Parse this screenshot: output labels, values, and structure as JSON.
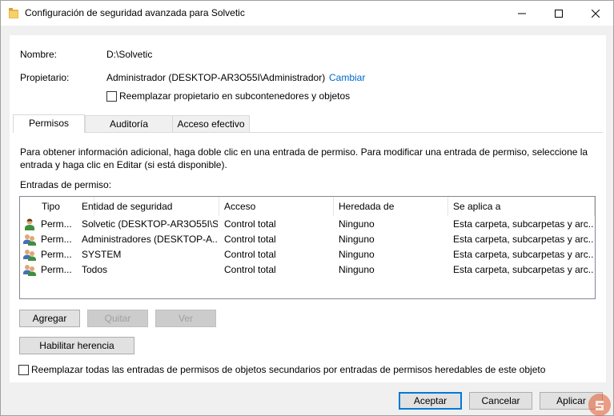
{
  "window": {
    "title": "Configuración de seguridad avanzada para Solvetic"
  },
  "info": {
    "name_label": "Nombre:",
    "name_value": "D:\\Solvetic",
    "owner_label": "Propietario:",
    "owner_value": "Administrador (DESKTOP-AR3O55I\\Administrador)",
    "change_link": "Cambiar",
    "replace_owner_label": "Reemplazar propietario en subcontenedores y objetos"
  },
  "tabs": [
    {
      "label": "Permisos",
      "active": true
    },
    {
      "label": "Auditoría",
      "active": false
    },
    {
      "label": "Acceso efectivo",
      "active": false
    }
  ],
  "description": "Para obtener información adicional, haga doble clic en una entrada de permiso. Para modificar una entrada de permiso, seleccione la entrada y haga clic en Editar (si está disponible).",
  "entries_label": "Entradas de permiso:",
  "table": {
    "columns": [
      "Tipo",
      "Entidad de seguridad",
      "Acceso",
      "Heredada de",
      "Se aplica a"
    ],
    "rows": [
      {
        "icon": "single-user-icon",
        "tipo": "Perm...",
        "entidad": "Solvetic (DESKTOP-AR3O55I\\S...",
        "acceso": "Control total",
        "heredada": "Ninguno",
        "aplica": "Esta carpeta, subcarpetas y arc..."
      },
      {
        "icon": "group-users-icon",
        "tipo": "Perm...",
        "entidad": "Administradores (DESKTOP-A...",
        "acceso": "Control total",
        "heredada": "Ninguno",
        "aplica": "Esta carpeta, subcarpetas y arc..."
      },
      {
        "icon": "group-users-icon",
        "tipo": "Perm...",
        "entidad": "SYSTEM",
        "acceso": "Control total",
        "heredada": "Ninguno",
        "aplica": "Esta carpeta, subcarpetas y arc..."
      },
      {
        "icon": "group-users-icon",
        "tipo": "Perm...",
        "entidad": "Todos",
        "acceso": "Control total",
        "heredada": "Ninguno",
        "aplica": "Esta carpeta, subcarpetas y arc..."
      }
    ]
  },
  "buttons": {
    "add": "Agregar",
    "remove": "Quitar",
    "view": "Ver",
    "enable_inheritance": "Habilitar herencia"
  },
  "replace_all_label": "Reemplazar todas las entradas de permisos de objetos secundarios por entradas de permisos heredables de este objeto",
  "footer": {
    "ok": "Aceptar",
    "cancel": "Cancelar",
    "apply": "Aplicar"
  }
}
